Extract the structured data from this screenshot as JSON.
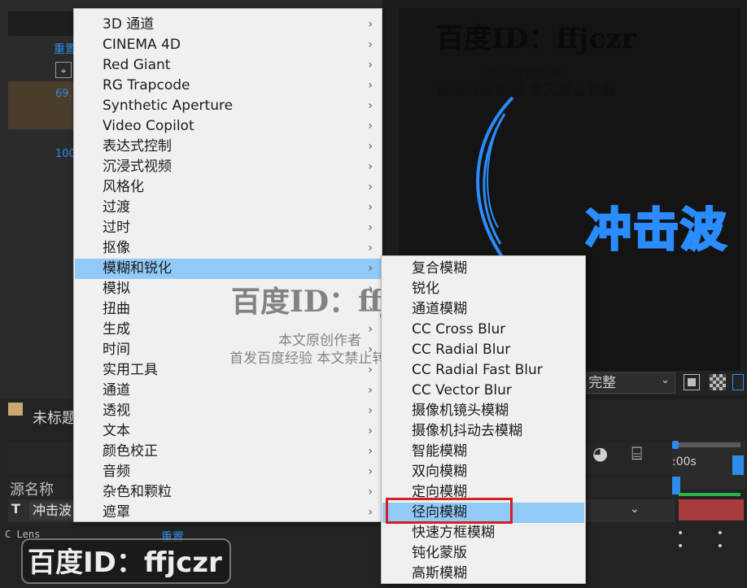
{
  "effect_controls": {
    "reset_label": "重置",
    "value_1": "69.",
    "value_2": "100"
  },
  "viewer": {
    "comp_text": "冲击波",
    "resolution": "完整"
  },
  "timeline": {
    "title": "未标题",
    "time_start": ":00s",
    "col_source_name": "源名称",
    "layer_type": "T",
    "layer_name": "冲击波",
    "effect_row_label": "C Lens",
    "effect_reset": "重置",
    "keyframes": "• • • •"
  },
  "watermarks": {
    "top_id": "百度ID：ffjczr",
    "top_line1": "本文原创作者",
    "top_line2": "首发百度经验  本文禁止转载",
    "mid_id": "百度ID：ffjczr",
    "mid_line1": "本文原创作者",
    "mid_line2": "首发百度经验  本文禁止转载",
    "bottom_id": "百度ID：ffjczr"
  },
  "main_menu": {
    "arrow": "›",
    "items": [
      {
        "label": "3D 通道"
      },
      {
        "label": "CINEMA 4D"
      },
      {
        "label": "Red Giant"
      },
      {
        "label": "RG Trapcode"
      },
      {
        "label": "Synthetic Aperture"
      },
      {
        "label": "Video Copilot"
      },
      {
        "label": "表达式控制"
      },
      {
        "label": "沉浸式视频"
      },
      {
        "label": "风格化"
      },
      {
        "label": "过渡"
      },
      {
        "label": "过时"
      },
      {
        "label": "抠像"
      },
      {
        "label": "模糊和锐化"
      },
      {
        "label": "模拟"
      },
      {
        "label": "扭曲"
      },
      {
        "label": "生成"
      },
      {
        "label": "时间"
      },
      {
        "label": "实用工具"
      },
      {
        "label": "通道"
      },
      {
        "label": "透视"
      },
      {
        "label": "文本"
      },
      {
        "label": "颜色校正"
      },
      {
        "label": "音频"
      },
      {
        "label": "杂色和颗粒"
      },
      {
        "label": "遮罩"
      }
    ]
  },
  "sub_menu": {
    "items": [
      {
        "label": "复合模糊"
      },
      {
        "label": "锐化"
      },
      {
        "label": "通道模糊"
      },
      {
        "label": "CC Cross Blur"
      },
      {
        "label": "CC Radial Blur"
      },
      {
        "label": "CC Radial Fast Blur"
      },
      {
        "label": "CC Vector Blur"
      },
      {
        "label": "摄像机镜头模糊"
      },
      {
        "label": "摄像机抖动去模糊"
      },
      {
        "label": "智能模糊"
      },
      {
        "label": "双向模糊"
      },
      {
        "label": "定向模糊"
      },
      {
        "label": "径向模糊"
      },
      {
        "label": "快速方框模糊"
      },
      {
        "label": "钝化蒙版"
      },
      {
        "label": "高斯模糊"
      }
    ]
  },
  "colors": {
    "menu_bg": "#f0f0f0",
    "menu_highlight": "#91c9f7",
    "annotation_red": "#d32020",
    "accent_blue": "#2d8ceb"
  }
}
